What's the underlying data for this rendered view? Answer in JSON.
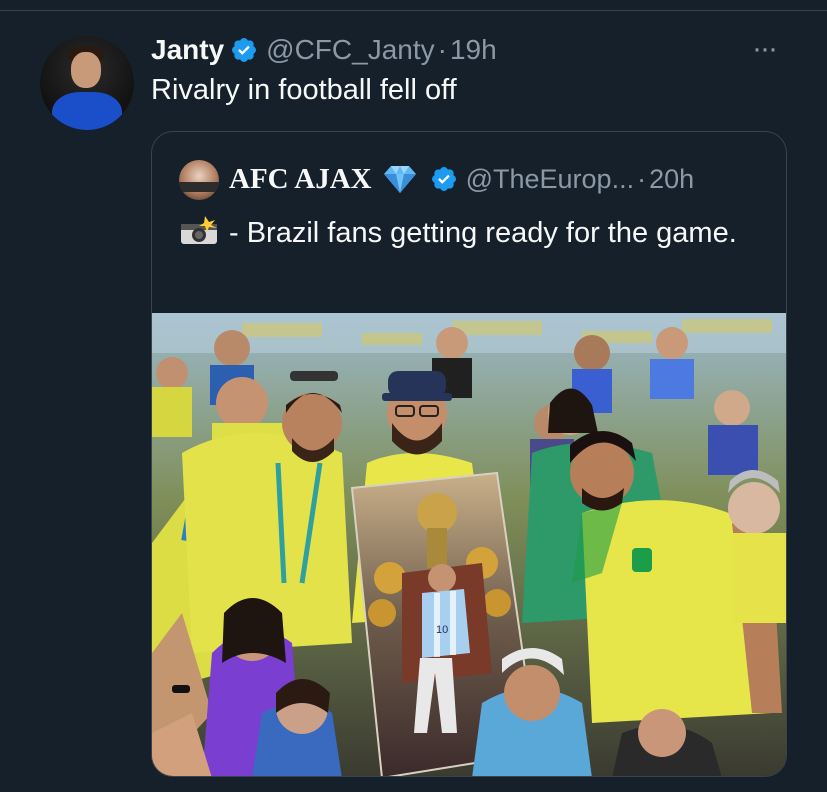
{
  "tweet": {
    "author_name": "Janty",
    "author_handle": "@CFC_Janty",
    "separator": "·",
    "time": "19h",
    "text": "Rivalry in football fell off",
    "more_icon": "more-icon",
    "more_label": "···"
  },
  "quoted_tweet": {
    "author_name": "AFC AJAX",
    "author_handle": "@TheEurop...",
    "separator": "·",
    "time": "20h",
    "text": "- Brazil fans getting ready for the game.",
    "icons": [
      "camera-flash-icon",
      "gem-icon",
      "verified-badge-icon"
    ]
  },
  "photo": {
    "description_icon": "stadium-photo",
    "banner_number": "10"
  },
  "colors": {
    "background": "#15202b",
    "text_primary": "#f7f9f9",
    "text_secondary": "#8b98a5",
    "verified": "#1d9bf0",
    "border": "#38444d",
    "jersey_yellow": "#e9e94a",
    "jersey_green": "#1c9d4a"
  }
}
